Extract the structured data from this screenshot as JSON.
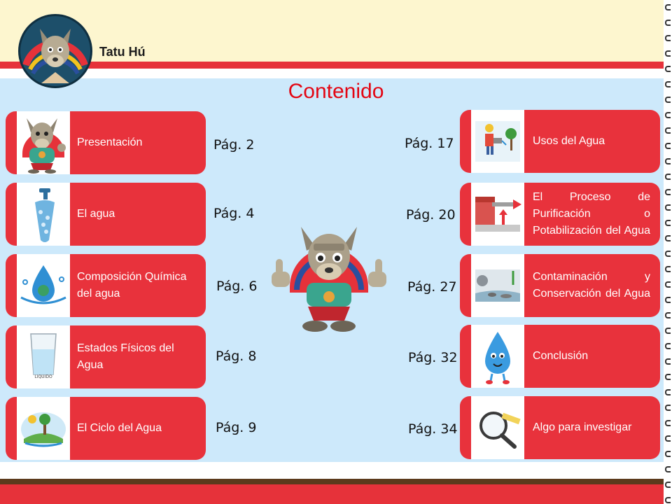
{
  "header": {
    "brand": "Tatu Hú"
  },
  "page_title": "Contenido",
  "colors": {
    "accent_red": "#e8323c",
    "title_red": "#e30613",
    "header_yellow": "#fdf6cf",
    "panel_blue": "#cde9fb",
    "footer_brown": "#5c3a1c"
  },
  "left_items": [
    {
      "label": "Presentación",
      "page": "Pág. 2",
      "icon": "mascot-icon"
    },
    {
      "label": "El agua",
      "page": "Pág. 4",
      "icon": "water-faucet-icon"
    },
    {
      "label": "Composición Química del agua",
      "page": "Pág. 6",
      "icon": "water-drop-icon"
    },
    {
      "label": "Estados  Físicos del Agua",
      "page": "Pág. 8",
      "icon": "water-glass-icon"
    },
    {
      "label": "El Ciclo del Agua",
      "page": "Pág. 9",
      "icon": "water-cycle-icon"
    }
  ],
  "right_items": [
    {
      "label": "Usos del Agua",
      "page": "Pág. 17",
      "icon": "watering-icon"
    },
    {
      "label": "El Proceso de Purificación o Potabilización del Agua",
      "page": "Pág. 20",
      "icon": "purification-tank-icon"
    },
    {
      "label": "Contaminación y Conservación del Agua",
      "page": "Pág. 27",
      "icon": "pollution-icon"
    },
    {
      "label": "Conclusión",
      "page": "Pág. 32",
      "icon": "drop-character-icon"
    },
    {
      "label": "Algo para investigar",
      "page": "Pág. 34",
      "icon": "magnifier-icon"
    }
  ],
  "image_text": {
    "glass_caption": "LIQUIDO"
  }
}
